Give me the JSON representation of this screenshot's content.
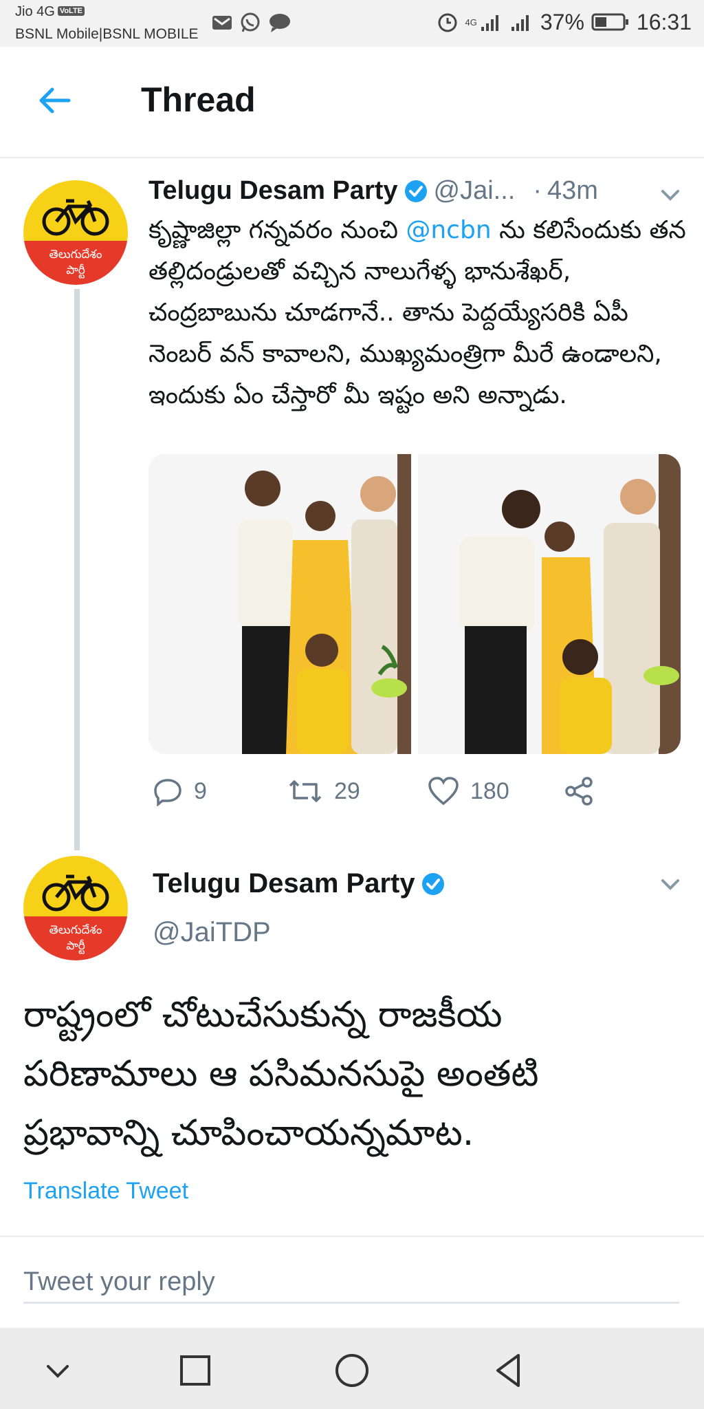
{
  "status_bar": {
    "carrier_line1": "Jio 4G",
    "volte_badge": "VoLTE",
    "carrier_line2": "BSNL Mobile|BSNL MOBILE",
    "network_label": "4G",
    "battery": "37%",
    "time": "16:31"
  },
  "header": {
    "title": "Thread"
  },
  "avatar": {
    "logo_text": "తెలుగుదేశం పార్టీ",
    "colors": {
      "top": "#f7d117",
      "bottom": "#e53a2a"
    }
  },
  "tweet1": {
    "name": "Telugu Desam Party",
    "handle": "@Jai...",
    "dot": "·",
    "time": "43m",
    "text_before_mention": "కృష్ణాజిల్లా గన్నవరం నుంచి ",
    "mention": "@ncbn",
    "text_after_mention": " ను కలిసేందుకు తన తల్లిదండ్రులతో వచ్చిన నాలుగేళ్ళ భానుశేఖర్, చంద్రబాబును చూడగానే.. తాను పెద్దయ్యేసరికి ఏపీ నెంబర్ వన్ కావాలని, ముఖ్యమంత్రిగా మీరే ఉండాలని, ఇందుకు ఏం చేస్తారో మీ ఇష్టం అని అన్నాడు.",
    "replies": "9",
    "retweets": "29",
    "likes": "180"
  },
  "tweet2": {
    "name": "Telugu Desam Party",
    "handle": "@JaiTDP",
    "text": "రాష్ట్రంలో చోటుచేసుకున్న రాజకీయ పరిణామాలు ఆ పసిమనసుపై అంతటి ప్రభావాన్ని చూపించాయన్నమాట.",
    "translate_label": "Translate Tweet"
  },
  "reply": {
    "placeholder": "Tweet your reply"
  },
  "colors": {
    "accent": "#1da1f2",
    "secondary_text": "#657786"
  }
}
